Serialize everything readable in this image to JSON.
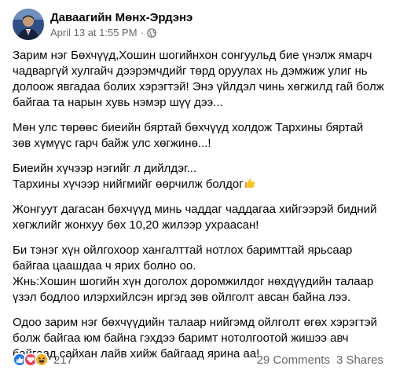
{
  "post": {
    "author": "Даваагийн Мөнх-Эрдэнэ",
    "date": "April 13 at 1:55 PM",
    "separator": "·",
    "privacy_icon": "globe-icon",
    "paragraphs": [
      {
        "lines": [
          "Зарим нэг Бөхчүүд,Хошин шогийнхон сонгуульд бие үнэлж ямарч",
          "чадваргүй хулгайч дээрэмчдийг төрд оруулах нь дэмжиж улиг нь",
          "долоож явгадаа болих хэрэгтэй! Энэ үйлдэл чинь хөгжилд гай болж",
          "байгаа та нарын хувь нэмэр шүү дээ..."
        ]
      },
      {
        "lines": [
          "Мөн улс төрөөс биеийн бяртай бөхчүүд холдож Тархины бяртай",
          "зөв хүмүүс гарч байж улс хөгжинө...!"
        ]
      },
      {
        "lines": [
          "Биеийн хүчээр нэгийг л дийлдэг...",
          "Тархины хүчээр нийгмийг өөрчилж болдог"
        ],
        "emoji_after_last": "thumbs-up-emoji"
      },
      {
        "lines": [
          "Жонгуут дагасан бөхчүүд минь чаддаг чаддагаа хийгээрэй бидний",
          "хөгжлийг жонхуу бөх 10,20 жилээр ухраасан!"
        ]
      },
      {
        "lines": [
          "Би тэнэг хүн ойлгохоор хангалттай нотлох баримттай ярьсаар",
          "байгаа цаашдаа ч ярих болно оо.",
          "Жнь:Хошин шогийн хүн доголох доромжилдог нөхдүүдийн талаар",
          "үзэл бодлоо илэрхийлсэн иргэд зөв ойлголт авсан байна лээ."
        ]
      },
      {
        "lines": [
          "Одоо зарим нэг бөхчүүдийн талаар нийгэмд ойлголт өгөх хэрэгтэй",
          "болж байгаа юм байна гэхдээ баримт нотолгоотой жишээ авч",
          "байгаад сайхан лайв хийж байгаад ярина аа!"
        ]
      }
    ]
  },
  "footer": {
    "reaction_icons": [
      "like-icon",
      "love-icon",
      "haha-icon"
    ],
    "reaction_count": "217",
    "comments": "29 Comments",
    "shares": "3 Shares"
  },
  "colors": {
    "text": "#050505",
    "secondary": "#65676b",
    "like": "#1877f2",
    "love": "#f33e58",
    "haha": "#f7b125"
  }
}
